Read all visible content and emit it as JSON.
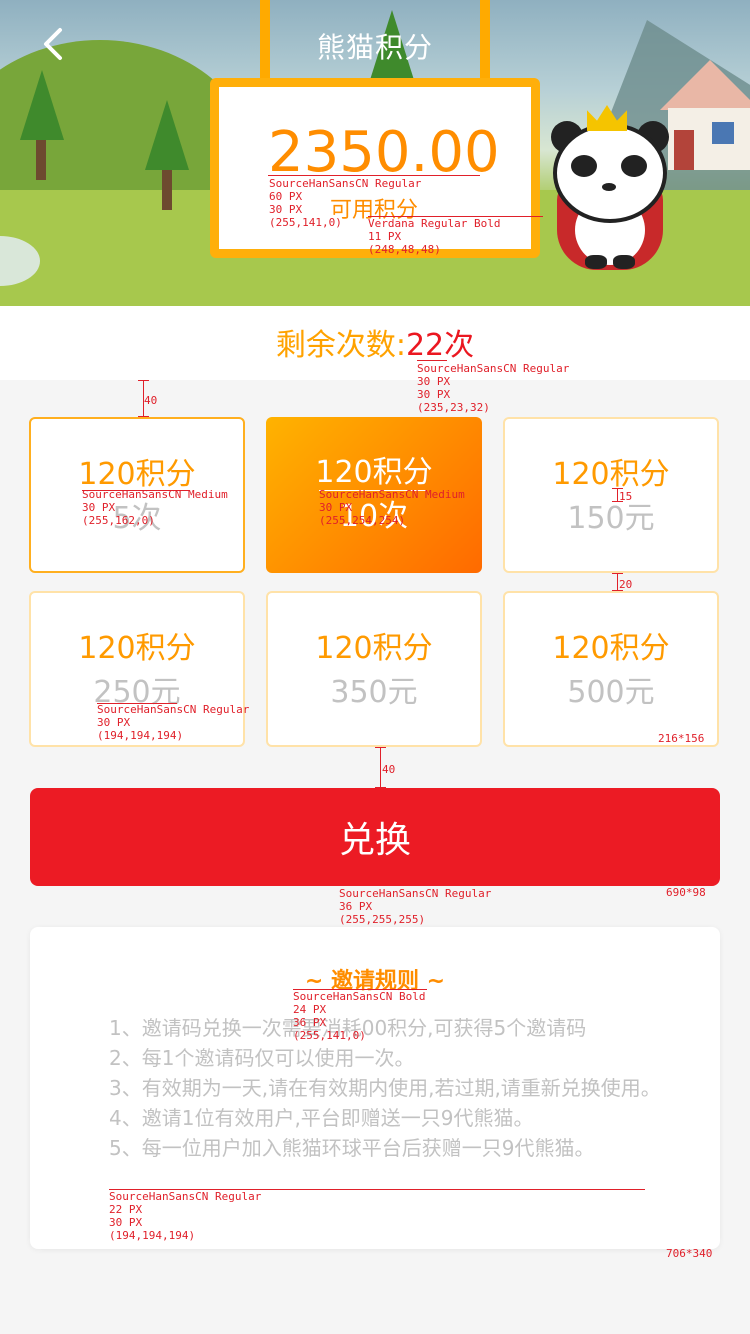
{
  "header": {
    "title": "熊猫积分",
    "back_icon": "chevron-left-icon"
  },
  "points": {
    "value": "2350.00",
    "label": "可用积分"
  },
  "remaining": {
    "label": "剩余次数:",
    "count": "22次"
  },
  "options": [
    {
      "points": "120积分",
      "price": "5次",
      "state": "outlined"
    },
    {
      "points": "120积分",
      "price": "10次",
      "state": "selected"
    },
    {
      "points": "120积分",
      "price": "150元",
      "state": "normal"
    },
    {
      "points": "120积分",
      "price": "250元",
      "state": "normal"
    },
    {
      "points": "120积分",
      "price": "350元",
      "state": "normal"
    },
    {
      "points": "120积分",
      "price": "500元",
      "state": "normal"
    }
  ],
  "exchange_button": {
    "label": "兑换"
  },
  "rules": {
    "title": "~ 邀请规则 ~",
    "items": [
      "1、邀请码兑换一次需要消耗00积分,可获得5个邀请码",
      "2、每1个邀请码仅可以使用一次。",
      "3、有效期为一天,请在有效期内使用,若过期,请重新兑换使用。",
      "4、邀请1位有效用户,平台即赠送一只9代熊猫。",
      "5、每一位用户加入熊猫环球平台后获赠一只9代熊猫。"
    ]
  },
  "annotations": {
    "points_value_spec": "SourceHanSansCN Regular\n60 PX\n30 PX\n(255,141,0)",
    "points_label_spec": "Verdana Regular Bold\n11 PX\n(248,48,48)",
    "remaining_spec": "SourceHanSansCN Regular\n30 PX\n30 PX\n(235,23,32)",
    "gap_top": "40",
    "option1_spec": "SourceHanSansCN Medium\n30 PX\n(255,162,0)",
    "option2_spec": "SourceHanSansCN Medium\n30 PX\n(255,254,254)",
    "gap_inner": "15",
    "gap_row": "20",
    "price_spec": "SourceHanSansCN Regular\n30 PX\n(194,194,194)",
    "option_size": "216*156",
    "gap_button": "40",
    "button_spec": "SourceHanSansCN Regular\n36 PX\n(255,255,255)",
    "button_size": "690*98",
    "rules_title_spec": "SourceHanSansCN Bold\n24 PX\n36 PX\n(255,141,0)",
    "rules_text_spec": "SourceHanSansCN Regular\n22 PX\n30 PX\n(194,194,194)",
    "rules_size": "706*340"
  },
  "colors": {
    "accent": "#ff8d00",
    "red": "#ec1b24",
    "muted": "#c2c2c2"
  }
}
